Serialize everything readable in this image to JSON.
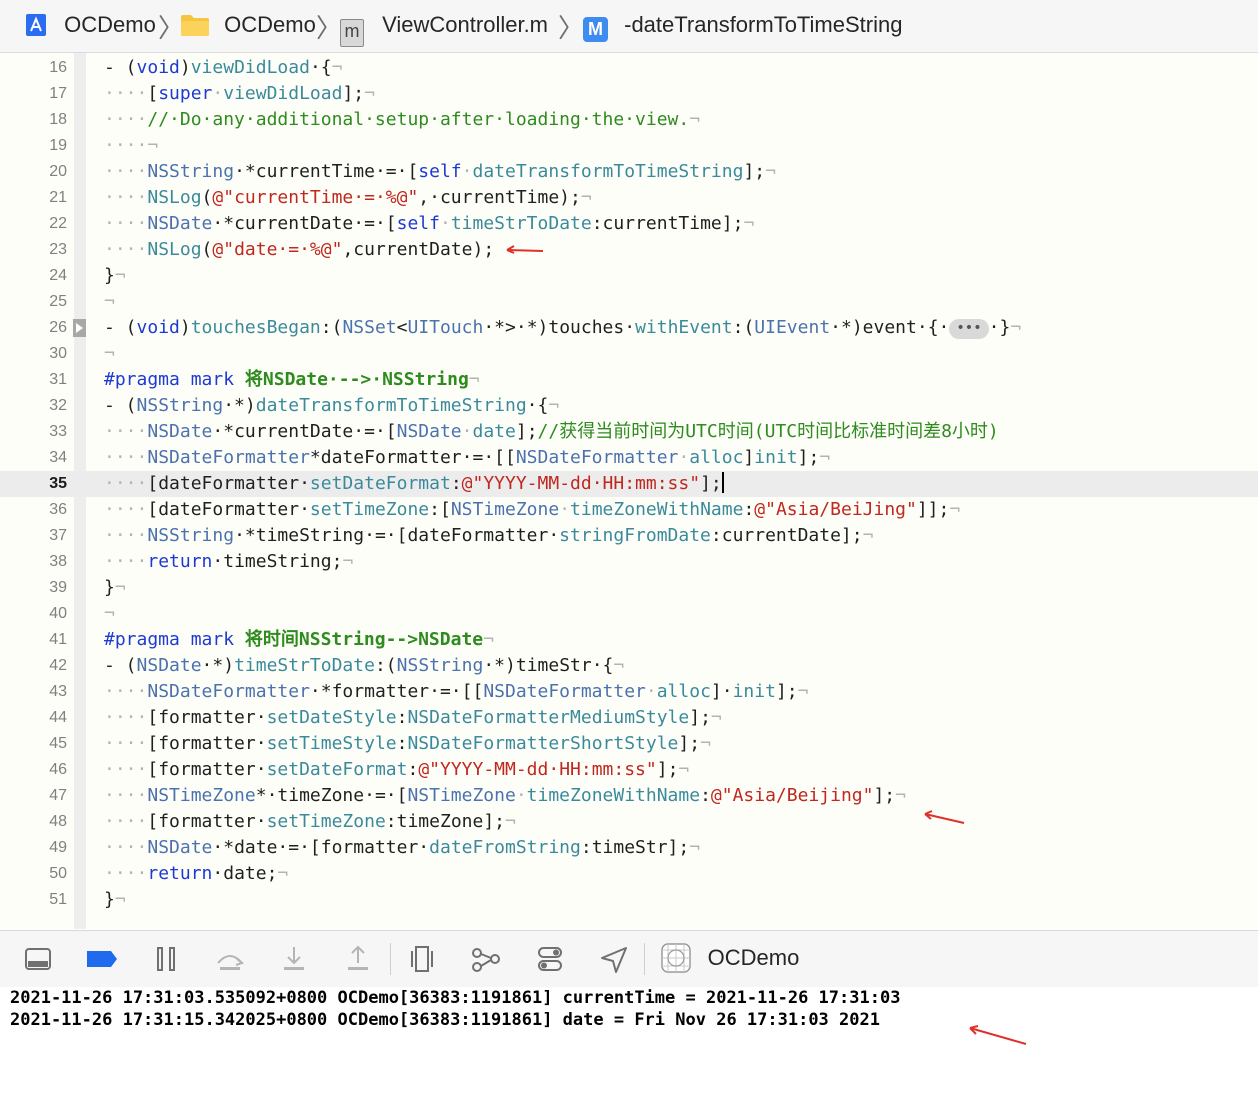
{
  "breadcrumb": {
    "project": "OCDemo",
    "group": "OCDemo",
    "file": "ViewController.m",
    "method": "-dateTransformToTimeString",
    "file_badge": "m",
    "method_badge": "M",
    "icons": [
      "xcode-project-icon",
      "folder-icon",
      "objc-file-icon",
      "method-icon"
    ]
  },
  "editor": {
    "current_line": "35",
    "line_numbers": [
      "16",
      "17",
      "18",
      "19",
      "20",
      "21",
      "22",
      "23",
      "24",
      "25",
      "26",
      "30",
      "31",
      "32",
      "33",
      "34",
      "35",
      "36",
      "37",
      "38",
      "39",
      "40",
      "41",
      "42",
      "43",
      "44",
      "45",
      "46",
      "47",
      "48",
      "49",
      "50",
      "51"
    ],
    "fold_ellipsis": "•••",
    "lines": [
      [
        [
          "- (",
          "p"
        ],
        [
          "void",
          "kw"
        ],
        [
          ")",
          "p"
        ],
        [
          "viewDidLoad",
          "fn"
        ],
        [
          "·{",
          "p"
        ],
        [
          "¬",
          "ws"
        ]
      ],
      [
        [
          "····",
          "ws"
        ],
        [
          "[",
          "p"
        ],
        [
          "super",
          "kw"
        ],
        [
          "·",
          "ws"
        ],
        [
          "viewDidLoad",
          "fn"
        ],
        [
          "];",
          "p"
        ],
        [
          "¬",
          "ws"
        ]
      ],
      [
        [
          "····",
          "ws"
        ],
        [
          "//·Do·any·additional·setup·after·loading·the·view.",
          "cm"
        ],
        [
          "¬",
          "ws"
        ]
      ],
      [
        [
          "····¬",
          "ws"
        ]
      ],
      [
        [
          "····",
          "ws"
        ],
        [
          "NSString",
          "ty"
        ],
        [
          "·*currentTime·=·[",
          "p"
        ],
        [
          "self",
          "kw"
        ],
        [
          "·",
          "ws"
        ],
        [
          "dateTransformToTimeString",
          "fn"
        ],
        [
          "];",
          "p"
        ],
        [
          "¬",
          "ws"
        ]
      ],
      [
        [
          "····",
          "ws"
        ],
        [
          "NSLog",
          "fn"
        ],
        [
          "(",
          "p"
        ],
        [
          "@\"currentTime·=·%@\"",
          "st"
        ],
        [
          ",·currentTime);",
          "p"
        ],
        [
          "¬",
          "ws"
        ]
      ],
      [
        [
          "····",
          "ws"
        ],
        [
          "NSDate",
          "ty"
        ],
        [
          "·*currentDate·=·[",
          "p"
        ],
        [
          "self",
          "kw"
        ],
        [
          "·",
          "ws"
        ],
        [
          "timeStrToDate",
          "fn"
        ],
        [
          ":currentTime];",
          "p"
        ],
        [
          "¬",
          "ws"
        ]
      ],
      [
        [
          "····",
          "ws"
        ],
        [
          "NSLog",
          "fn"
        ],
        [
          "(",
          "p"
        ],
        [
          "@\"date·=·%@\"",
          "st"
        ],
        [
          ",currentDate);",
          "p"
        ]
      ],
      [
        [
          "}",
          "p"
        ],
        [
          "¬",
          "ws"
        ]
      ],
      [
        [
          "¬",
          "ws"
        ]
      ],
      [
        [
          "- (",
          "p"
        ],
        [
          "void",
          "kw"
        ],
        [
          ")",
          "p"
        ],
        [
          "touchesBegan",
          "fn"
        ],
        [
          ":(",
          "p"
        ],
        [
          "NSSet",
          "ty"
        ],
        [
          "<",
          "p"
        ],
        [
          "UITouch",
          "ty"
        ],
        [
          "·*>·*)touches·",
          "p"
        ],
        [
          "withEvent",
          "fn"
        ],
        [
          ":(",
          "p"
        ],
        [
          "UIEvent",
          "ty"
        ],
        [
          "·*)event·{·",
          "p"
        ],
        [
          "•••",
          "ellip"
        ],
        [
          "·}",
          "p"
        ],
        [
          "¬",
          "ws"
        ]
      ],
      [
        [
          "¬",
          "ws"
        ]
      ],
      [
        [
          "#pragma mark ",
          "pr"
        ],
        [
          "将NSDate·-->·NSString",
          "gt"
        ],
        [
          "¬",
          "ws"
        ]
      ],
      [
        [
          "- (",
          "p"
        ],
        [
          "NSString",
          "ty"
        ],
        [
          "·*)",
          "p"
        ],
        [
          "dateTransformToTimeString",
          "fn"
        ],
        [
          "·{",
          "p"
        ],
        [
          "¬",
          "ws"
        ]
      ],
      [
        [
          "····",
          "ws"
        ],
        [
          "NSDate",
          "ty"
        ],
        [
          "·*currentDate·=·[",
          "p"
        ],
        [
          "NSDate",
          "ty"
        ],
        [
          "·",
          "ws"
        ],
        [
          "date",
          "fn"
        ],
        [
          "];",
          "p"
        ],
        [
          "//获得当前时间为UTC时间(UTC时间比标准时间差8小时)",
          "cm"
        ]
      ],
      [
        [
          "····",
          "ws"
        ],
        [
          "NSDateFormatter",
          "ty"
        ],
        [
          "*dateFormatter·=·[[",
          "p"
        ],
        [
          "NSDateFormatter",
          "ty"
        ],
        [
          "·",
          "ws"
        ],
        [
          "alloc",
          "fn"
        ],
        [
          "]",
          "p"
        ],
        [
          "init",
          "fn"
        ],
        [
          "];",
          "p"
        ],
        [
          "¬",
          "ws"
        ]
      ],
      [
        [
          "····",
          "ws"
        ],
        [
          "[dateFormatter·",
          "p"
        ],
        [
          "setDateFormat",
          "fn"
        ],
        [
          ":",
          "p"
        ],
        [
          "@\"YYYY-MM-dd·HH:mm:ss\"",
          "st"
        ],
        [
          "];",
          "p"
        ],
        [
          "|",
          "cursor"
        ]
      ],
      [
        [
          "····",
          "ws"
        ],
        [
          "[dateFormatter·",
          "p"
        ],
        [
          "setTimeZone",
          "fn"
        ],
        [
          ":[",
          "p"
        ],
        [
          "NSTimeZone",
          "ty"
        ],
        [
          "·",
          "ws"
        ],
        [
          "timeZoneWithName",
          "fn"
        ],
        [
          ":",
          "p"
        ],
        [
          "@\"Asia/BeiJing\"",
          "st"
        ],
        [
          "]];",
          "p"
        ],
        [
          "¬",
          "ws"
        ]
      ],
      [
        [
          "····",
          "ws"
        ],
        [
          "NSString",
          "ty"
        ],
        [
          "·*timeString·=·[dateFormatter·",
          "p"
        ],
        [
          "stringFromDate",
          "fn"
        ],
        [
          ":currentDate];",
          "p"
        ],
        [
          "¬",
          "ws"
        ]
      ],
      [
        [
          "····",
          "ws"
        ],
        [
          "return",
          "kw"
        ],
        [
          "·timeString;",
          "p"
        ],
        [
          "¬",
          "ws"
        ]
      ],
      [
        [
          "}",
          "p"
        ],
        [
          "¬",
          "ws"
        ]
      ],
      [
        [
          "¬",
          "ws"
        ]
      ],
      [
        [
          "#pragma mark ",
          "pr"
        ],
        [
          "将时间NSString-->NSDate",
          "gt"
        ],
        [
          "¬",
          "ws"
        ]
      ],
      [
        [
          "- (",
          "p"
        ],
        [
          "NSDate",
          "ty"
        ],
        [
          "·*)",
          "p"
        ],
        [
          "timeStrToDate",
          "fn"
        ],
        [
          ":(",
          "p"
        ],
        [
          "NSString",
          "ty"
        ],
        [
          "·*)timeStr·{",
          "p"
        ],
        [
          "¬",
          "ws"
        ]
      ],
      [
        [
          "····",
          "ws"
        ],
        [
          "NSDateFormatter",
          "ty"
        ],
        [
          "·*formatter·=·[[",
          "p"
        ],
        [
          "NSDateFormatter",
          "ty"
        ],
        [
          "·",
          "ws"
        ],
        [
          "alloc",
          "fn"
        ],
        [
          "]·",
          "p"
        ],
        [
          "init",
          "fn"
        ],
        [
          "];",
          "p"
        ],
        [
          "¬",
          "ws"
        ]
      ],
      [
        [
          "····",
          "ws"
        ],
        [
          "[formatter·",
          "p"
        ],
        [
          "setDateStyle",
          "fn"
        ],
        [
          ":",
          "p"
        ],
        [
          "NSDateFormatterMediumStyle",
          "fn"
        ],
        [
          "];",
          "p"
        ],
        [
          "¬",
          "ws"
        ]
      ],
      [
        [
          "····",
          "ws"
        ],
        [
          "[formatter·",
          "p"
        ],
        [
          "setTimeStyle",
          "fn"
        ],
        [
          ":",
          "p"
        ],
        [
          "NSDateFormatterShortStyle",
          "fn"
        ],
        [
          "];",
          "p"
        ],
        [
          "¬",
          "ws"
        ]
      ],
      [
        [
          "····",
          "ws"
        ],
        [
          "[formatter·",
          "p"
        ],
        [
          "setDateFormat",
          "fn"
        ],
        [
          ":",
          "p"
        ],
        [
          "@\"YYYY-MM-dd·HH:mm:ss\"",
          "st"
        ],
        [
          "];",
          "p"
        ],
        [
          "¬",
          "ws"
        ]
      ],
      [
        [
          "····",
          "ws"
        ],
        [
          "NSTimeZone",
          "ty"
        ],
        [
          "*·timeZone·=·[",
          "p"
        ],
        [
          "NSTimeZone",
          "ty"
        ],
        [
          "·",
          "ws"
        ],
        [
          "timeZoneWithName",
          "fn"
        ],
        [
          ":",
          "p"
        ],
        [
          "@\"Asia/Beijing\"",
          "st"
        ],
        [
          "];",
          "p"
        ],
        [
          "¬",
          "ws"
        ]
      ],
      [
        [
          "····",
          "ws"
        ],
        [
          "[formatter·",
          "p"
        ],
        [
          "setTimeZone",
          "fn"
        ],
        [
          ":timeZone];",
          "p"
        ],
        [
          "¬",
          "ws"
        ]
      ],
      [
        [
          "····",
          "ws"
        ],
        [
          "NSDate",
          "ty"
        ],
        [
          "·*date·=·[formatter·",
          "p"
        ],
        [
          "dateFromString",
          "fn"
        ],
        [
          ":timeStr];",
          "p"
        ],
        [
          "¬",
          "ws"
        ]
      ],
      [
        [
          "····",
          "ws"
        ],
        [
          "return",
          "kw"
        ],
        [
          "·date;",
          "p"
        ],
        [
          "¬",
          "ws"
        ]
      ],
      [
        [
          "}",
          "p"
        ],
        [
          "¬",
          "ws"
        ]
      ]
    ]
  },
  "debug_bar": {
    "target": "OCDemo",
    "buttons": [
      "hide-debug-area-button",
      "breakpoints-toggle-button",
      "pause-button",
      "step-over-button",
      "step-into-button",
      "step-out-button",
      "view-hierarchy-button",
      "memory-graph-button",
      "environment-overrides-button",
      "simulate-location-button",
      "target-app-icon"
    ]
  },
  "console": {
    "lines": [
      "2021-11-26 17:31:03.535092+0800 OCDemo[36383:1191861] currentTime = 2021-11-26 17:31:03",
      "2021-11-26 17:31:15.342025+0800 OCDemo[36383:1191861] date = Fri Nov 26 17:31:03 2021"
    ]
  },
  "colors": {
    "keyword": "#1d3ad3",
    "type": "#4b72ad",
    "method": "#3a8a9c",
    "string": "#c0271e",
    "comment": "#2e8b1e",
    "annotation_arrow": "#e0302a",
    "accent": "#1f6bf0"
  }
}
